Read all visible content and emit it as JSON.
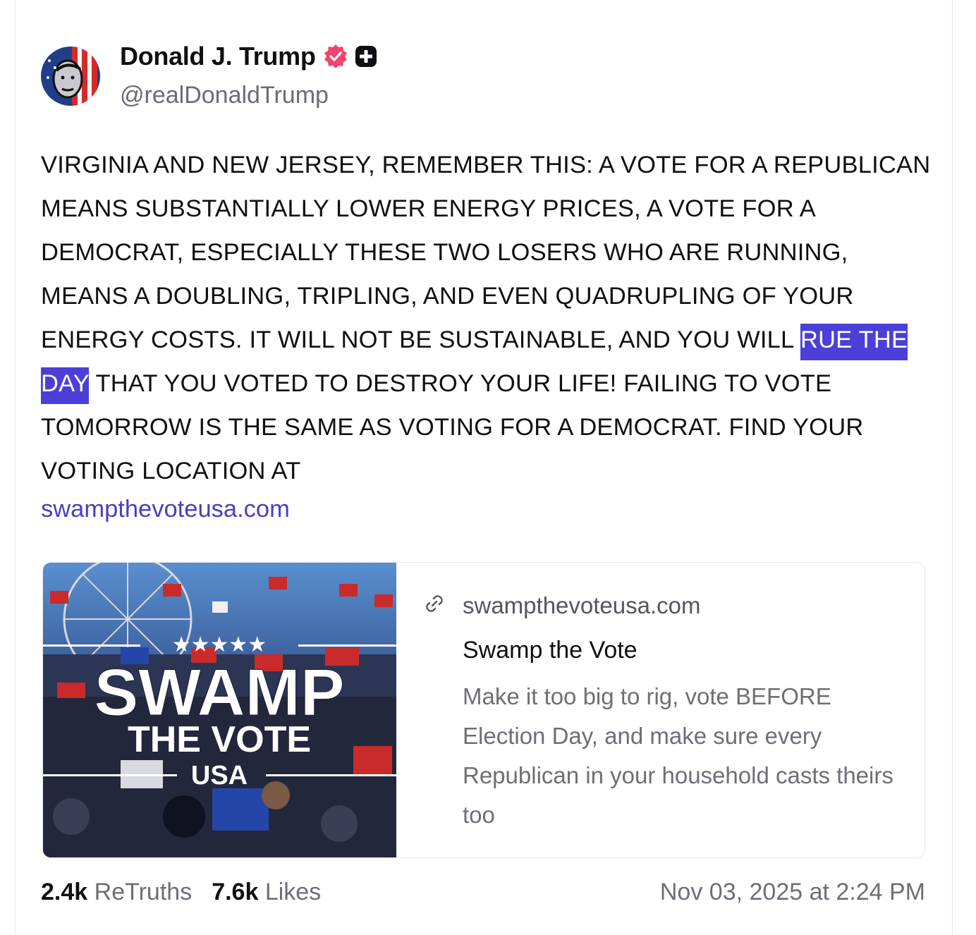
{
  "author": {
    "name": "Donald J. Trump",
    "handle": "@realDonaldTrump"
  },
  "post": {
    "text_before": "VIRGINIA AND NEW JERSEY, REMEMBER THIS: A VOTE FOR A REPUBLICAN MEANS SUBSTANTIALLY LOWER ENERGY PRICES, A VOTE FOR A DEMOCRAT, ESPECIALLY THESE TWO LOSERS WHO ARE RUNNING, MEANS A DOUBLING, TRIPLING, AND EVEN QUADRUPLING OF YOUR ENERGY COSTS. IT WILL NOT BE SUSTAINABLE, AND YOU WILL ",
    "text_highlighted": "RUE THE DAY",
    "text_after": " THAT YOU VOTED TO DESTROY YOUR LIFE! FAILING TO VOTE TOMORROW IS THE SAME AS VOTING FOR A DEMOCRAT. FIND YOUR VOTING LOCATION AT",
    "link": "swampthevoteusa.com"
  },
  "preview": {
    "domain": "swampthevoteusa.com",
    "title": "Swamp the Vote",
    "description": "Make it too big to rig, vote BEFORE Election Day, and make sure every Republican in your household casts theirs too",
    "image_text": {
      "stars": "★★★★★",
      "line1": "SWAMP",
      "line2": "THE VOTE",
      "line3": "USA"
    }
  },
  "stats": {
    "retruths_count": "2.4k",
    "retruths_label": "ReTruths",
    "likes_count": "7.6k",
    "likes_label": "Likes"
  },
  "timestamp": "Nov 03, 2025 at 2:24 PM",
  "colors": {
    "verified": "#f2456e",
    "highlight": "#4b3fd8",
    "link": "#4a3fbd",
    "muted": "#6e6e78"
  }
}
